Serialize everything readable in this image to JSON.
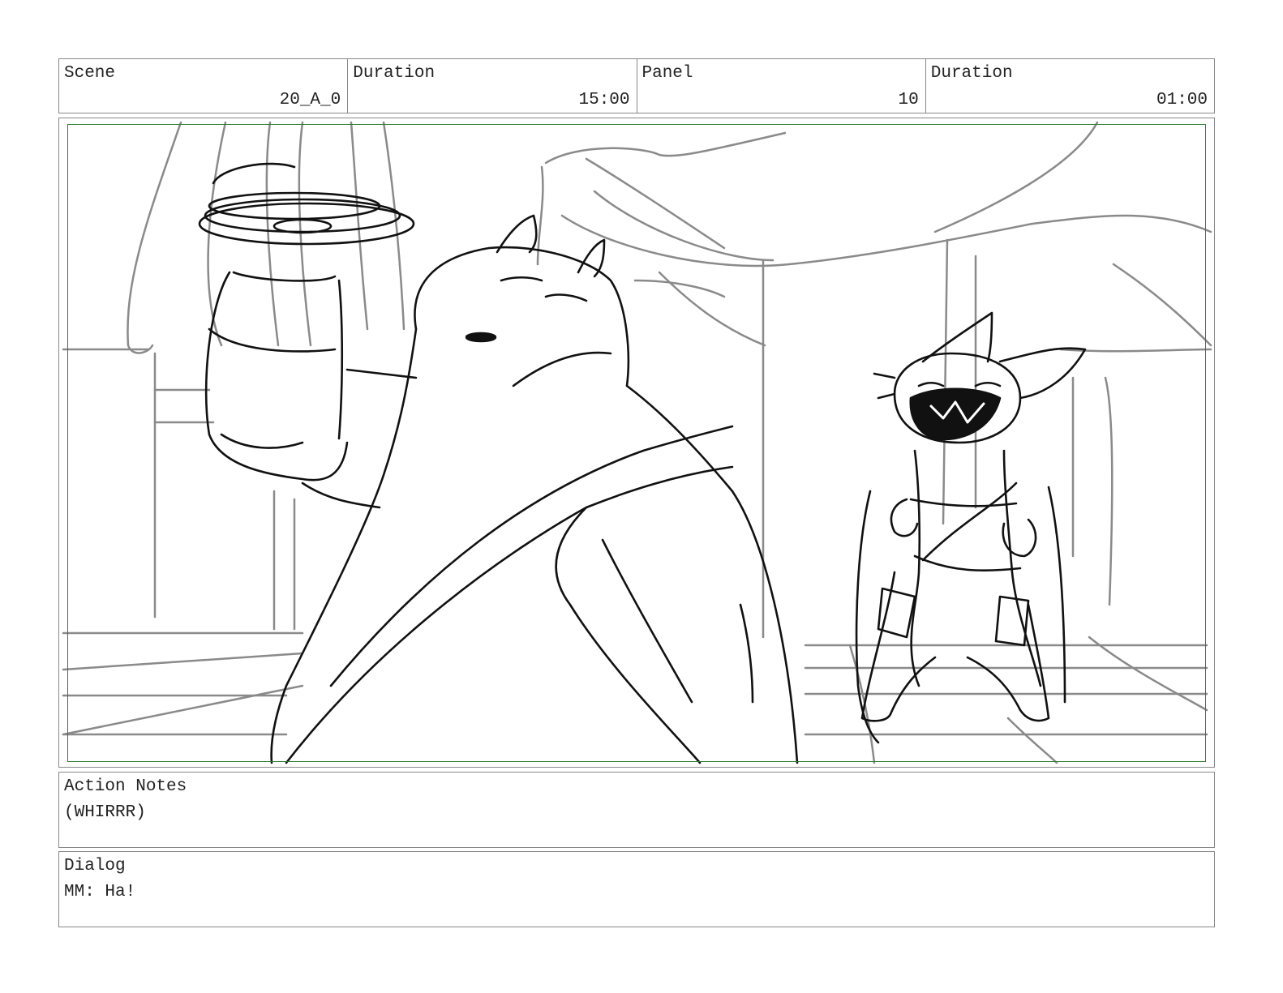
{
  "header": {
    "scene_label": "Scene",
    "scene_value": "20_A_0",
    "scene_duration_label": "Duration",
    "scene_duration_value": "15:00",
    "panel_label": "Panel",
    "panel_value": "10",
    "panel_duration_label": "Duration",
    "panel_duration_value": "01:00"
  },
  "action_notes": {
    "label": "Action Notes",
    "text": "(WHIRRR)"
  },
  "dialog": {
    "label": "Dialog",
    "text": "MM: Ha!"
  },
  "colors": {
    "border": "#888888",
    "safe_frame": "#2e7d32",
    "sketch_dark": "#111111",
    "sketch_light": "#8a8a8a"
  }
}
